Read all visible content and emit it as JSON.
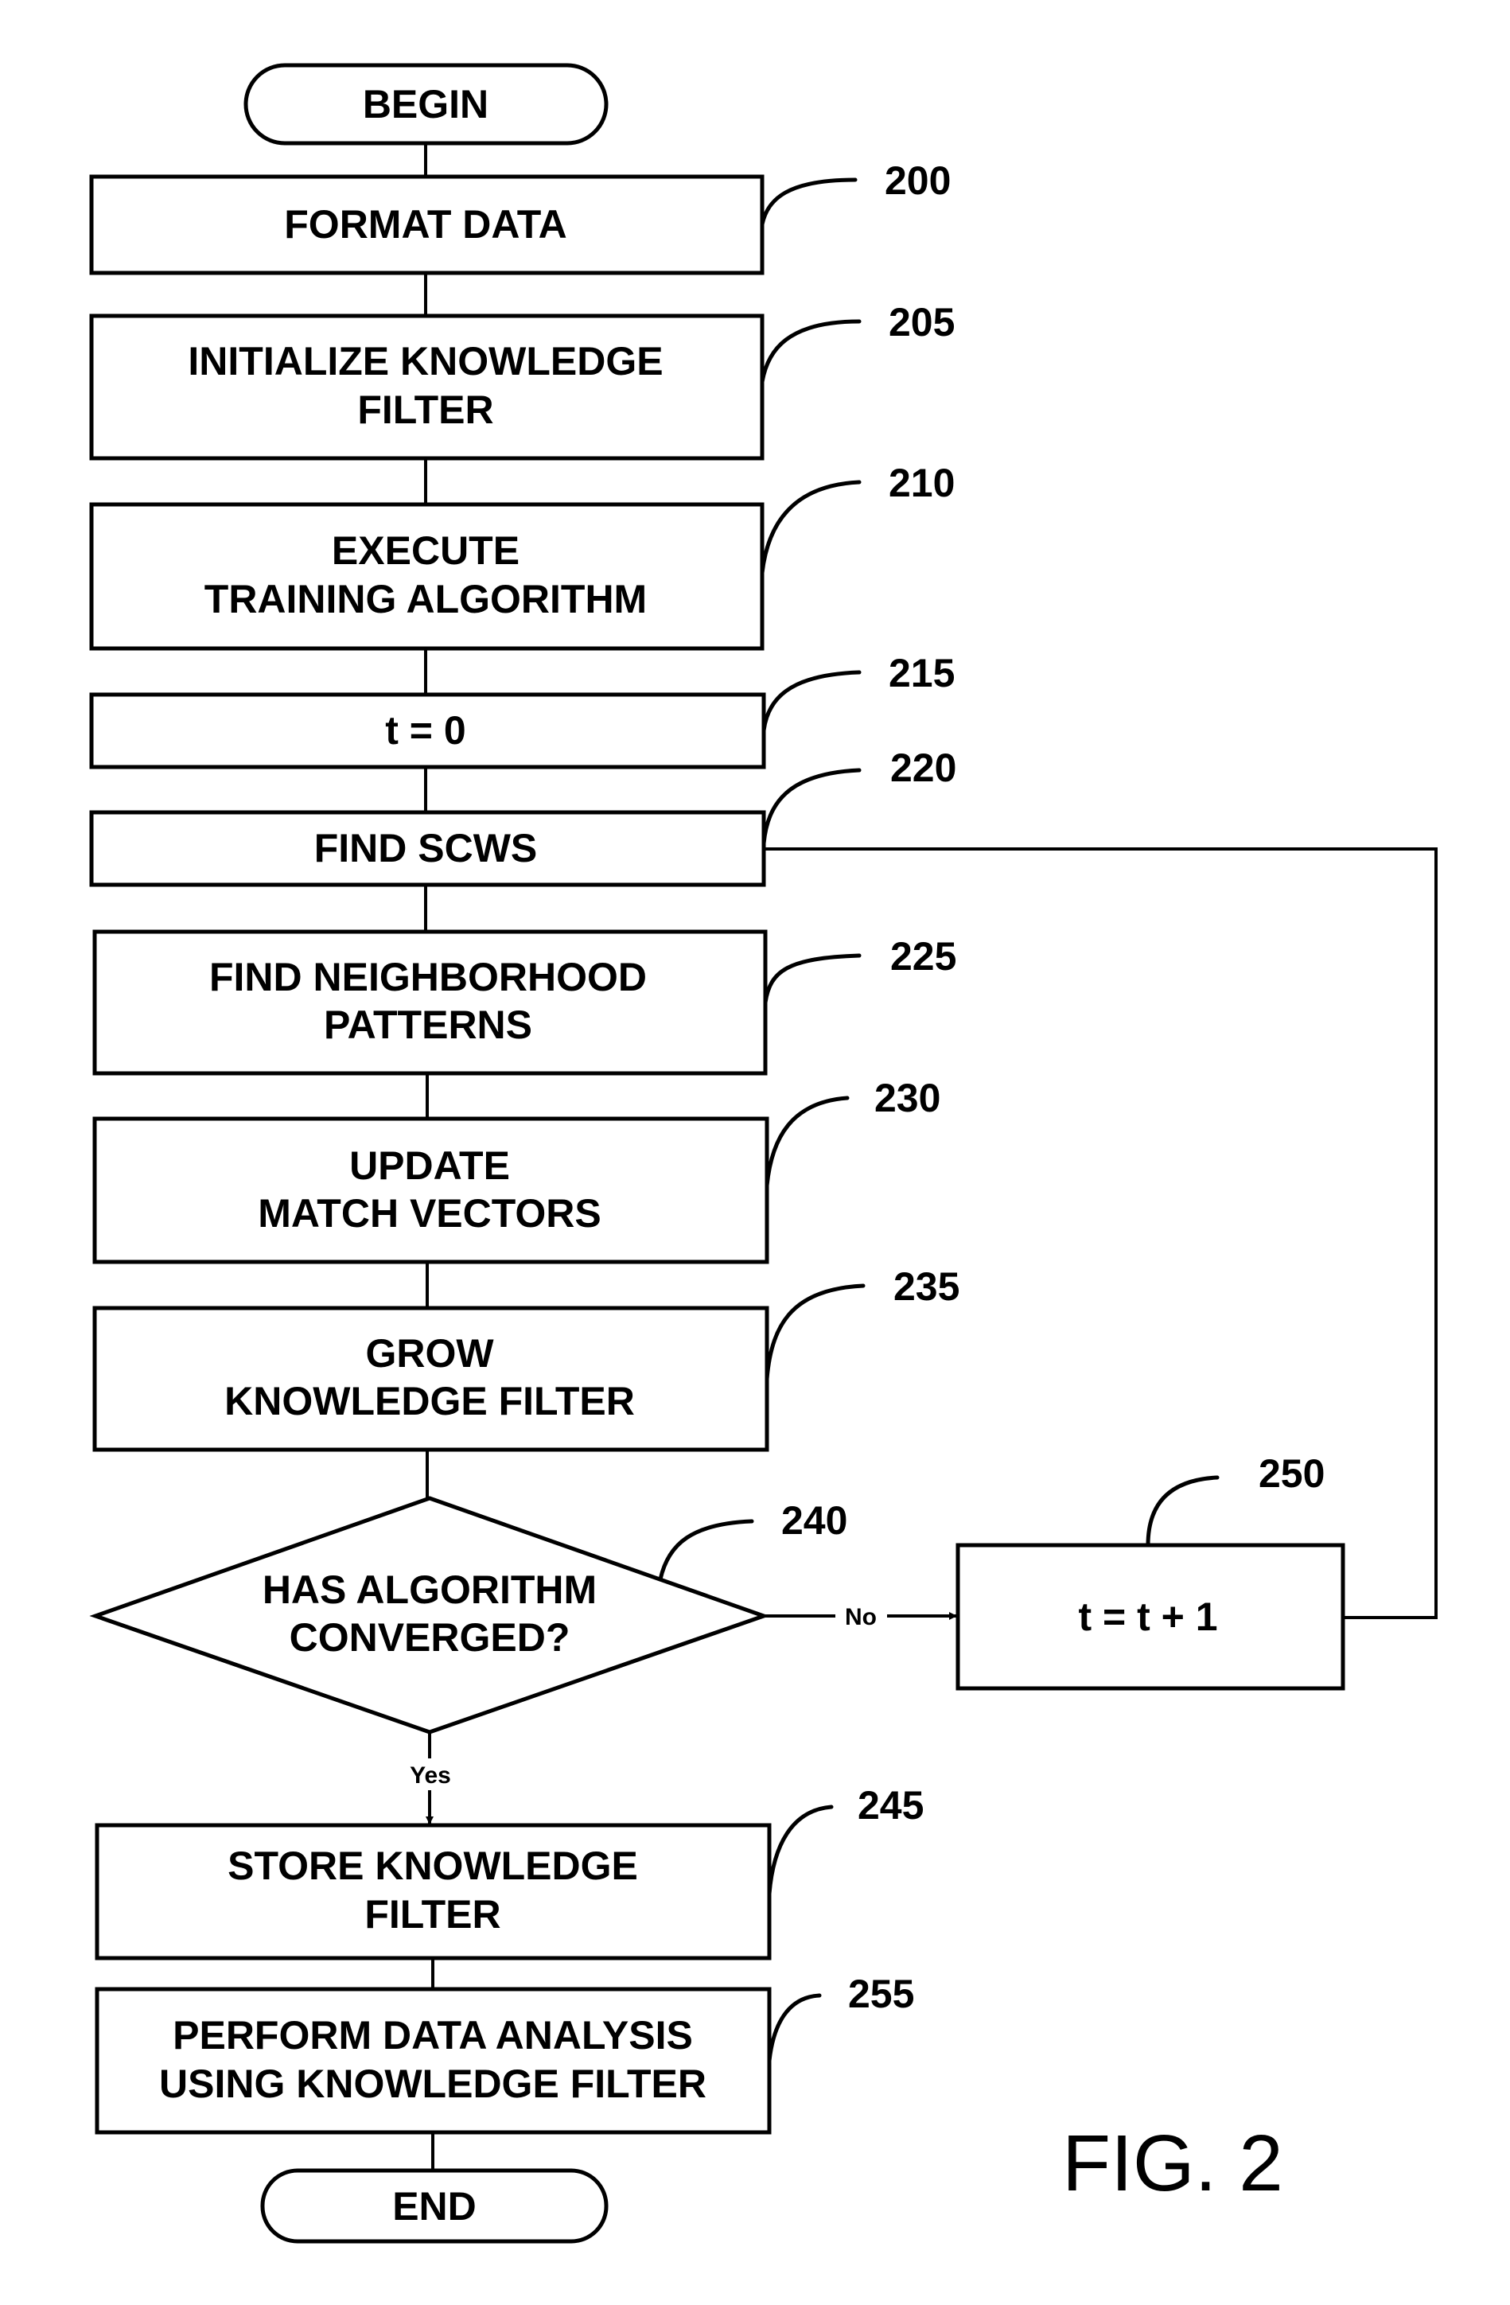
{
  "figure": {
    "caption": "FIG. 2",
    "nodes": {
      "begin": {
        "type": "terminal",
        "label": "BEGIN"
      },
      "n200": {
        "type": "process",
        "ref": "200",
        "lines": [
          "FORMAT DATA"
        ]
      },
      "n205": {
        "type": "process",
        "ref": "205",
        "lines": [
          "INITIALIZE KNOWLEDGE",
          "FILTER"
        ]
      },
      "n210": {
        "type": "process",
        "ref": "210",
        "lines": [
          "EXECUTE",
          "TRAINING ALGORITHM"
        ]
      },
      "n215": {
        "type": "process",
        "ref": "215",
        "lines": [
          "t = 0"
        ]
      },
      "n220": {
        "type": "process",
        "ref": "220",
        "lines": [
          "FIND SCWS"
        ]
      },
      "n225": {
        "type": "process",
        "ref": "225",
        "lines": [
          "FIND NEIGHBORHOOD",
          "PATTERNS"
        ]
      },
      "n230": {
        "type": "process",
        "ref": "230",
        "lines": [
          "UPDATE",
          "MATCH VECTORS"
        ]
      },
      "n235": {
        "type": "process",
        "ref": "235",
        "lines": [
          "GROW",
          "KNOWLEDGE FILTER"
        ]
      },
      "n240": {
        "type": "decision",
        "ref": "240",
        "lines": [
          "HAS ALGORITHM",
          "CONVERGED?"
        ]
      },
      "n250": {
        "type": "process",
        "ref": "250",
        "lines": [
          "t = t + 1"
        ]
      },
      "n245": {
        "type": "process",
        "ref": "245",
        "lines": [
          "STORE KNOWLEDGE",
          "FILTER"
        ]
      },
      "n255": {
        "type": "process",
        "ref": "255",
        "lines": [
          "PERFORM DATA ANALYSIS",
          "USING KNOWLEDGE FILTER"
        ]
      },
      "end": {
        "type": "terminal",
        "label": "END"
      }
    },
    "edges": {
      "no_label": "No",
      "yes_label": "Yes"
    }
  }
}
